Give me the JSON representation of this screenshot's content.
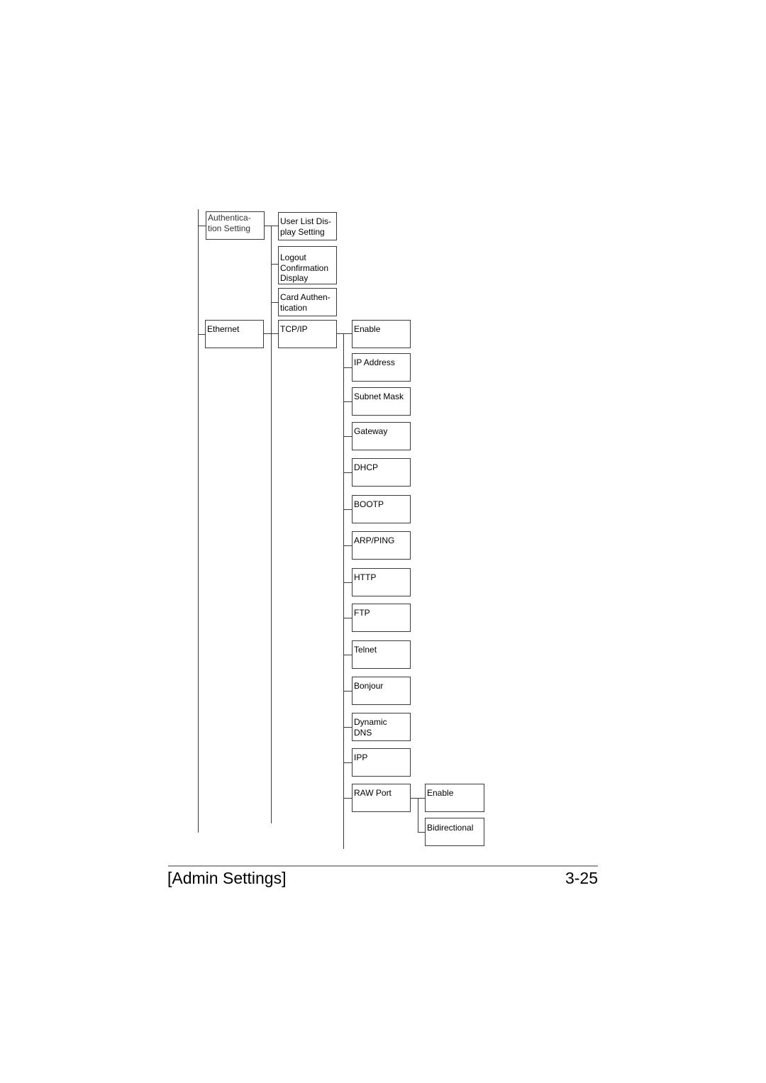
{
  "tree": {
    "level1": [
      {
        "label": "Authentica-\ntion Setting"
      },
      {
        "label": "Ethernet"
      }
    ],
    "authentication_children": [
      {
        "label": "User List Dis-\nplay Setting"
      },
      {
        "label": "Logout\nConfirmation\nDisplay"
      },
      {
        "label": "Card Authen-\ntication"
      }
    ],
    "ethernet_children": [
      {
        "label": "TCP/IP"
      }
    ],
    "tcpip_children": [
      {
        "label": "Enable"
      },
      {
        "label": "IP Address"
      },
      {
        "label": "Subnet Mask"
      },
      {
        "label": "Gateway"
      },
      {
        "label": "DHCP"
      },
      {
        "label": "BOOTP"
      },
      {
        "label": "ARP/PING"
      },
      {
        "label": "HTTP"
      },
      {
        "label": "FTP"
      },
      {
        "label": "Telnet"
      },
      {
        "label": "Bonjour"
      },
      {
        "label": "Dynamic\nDNS"
      },
      {
        "label": "IPP"
      },
      {
        "label": "RAW Port"
      }
    ],
    "rawport_children": [
      {
        "label": "Enable"
      },
      {
        "label": "Bidirectional"
      }
    ]
  },
  "footer": {
    "section_title": "[Admin Settings]",
    "page_number": "3-25"
  }
}
